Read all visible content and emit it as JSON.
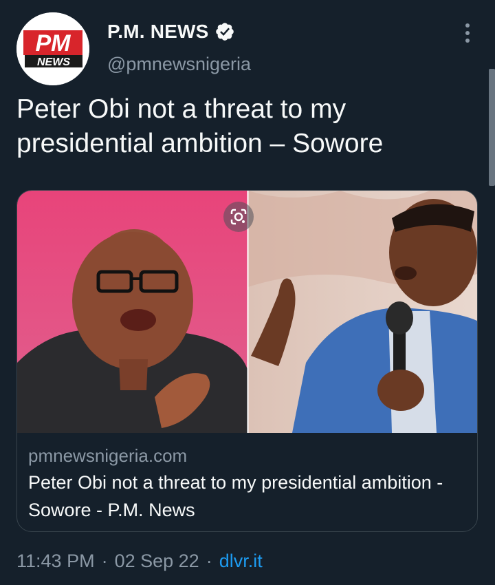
{
  "author": {
    "display_name": "P.M. NEWS",
    "handle": "@pmnewsnigeria",
    "avatar_logo_text_top": "PM",
    "avatar_logo_text_bottom": "NEWS",
    "verified": true
  },
  "tweet": {
    "text": "Peter Obi not a threat to my presidential ambition – Sowore"
  },
  "card": {
    "domain": "pmnewsnigeria.com",
    "title": "Peter Obi not a threat to my presidential ambition - Sowore - P.M. News"
  },
  "footer": {
    "time": "11:43 PM",
    "sep1": "·",
    "date": "02 Sep 22",
    "sep2": "·",
    "source": "dlvr.it"
  },
  "colors": {
    "background": "#15202b",
    "text_primary": "#f7f9f9",
    "text_secondary": "#8b98a5",
    "link": "#1d9bf0",
    "border": "#38444d",
    "logo_red": "#d8252b"
  },
  "icons": {
    "verified": "verified-badge-icon",
    "more": "more-vertical-icon",
    "lens": "google-lens-icon"
  }
}
